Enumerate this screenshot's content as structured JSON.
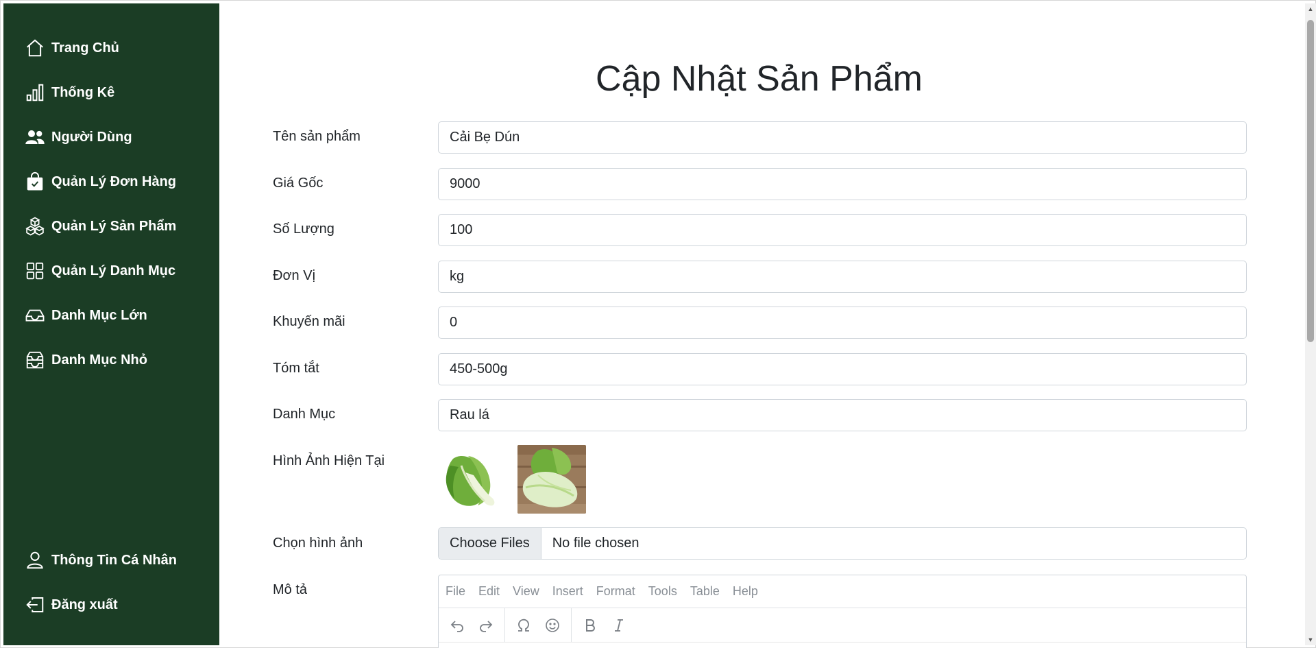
{
  "sidebar": {
    "items": [
      {
        "label": "Trang Chủ",
        "icon": "house-icon"
      },
      {
        "label": "Thống Kê",
        "icon": "bar-chart-icon"
      },
      {
        "label": "Người Dùng",
        "icon": "users-icon"
      },
      {
        "label": "Quản Lý Đơn Hàng",
        "icon": "shopping-bag-check-icon"
      },
      {
        "label": "Quản Lý Sản Phẩm",
        "icon": "boxes-icon"
      },
      {
        "label": "Quản Lý Danh Mục",
        "icon": "grid-icon"
      },
      {
        "label": "Danh Mục Lớn",
        "icon": "inbox-icon"
      },
      {
        "label": "Danh Mục Nhỏ",
        "icon": "inboxes-icon"
      }
    ],
    "bottom": [
      {
        "label": "Thông Tin Cá Nhân",
        "icon": "person-icon"
      },
      {
        "label": "Đăng xuất",
        "icon": "box-arrow-left-icon"
      }
    ]
  },
  "page": {
    "title": "Cập Nhật Sản Phẩm"
  },
  "form": {
    "name": {
      "label": "Tên sản phẩm",
      "value": "Cải Bẹ Dún"
    },
    "price": {
      "label": "Giá Gốc",
      "value": "9000"
    },
    "quantity": {
      "label": "Số Lượng",
      "value": "100"
    },
    "unit": {
      "label": "Đơn Vị",
      "value": "kg"
    },
    "discount": {
      "label": "Khuyến mãi",
      "value": "0"
    },
    "summary": {
      "label": "Tóm tắt",
      "value": "450-500g"
    },
    "category": {
      "label": "Danh Mục",
      "value": "Rau lá"
    },
    "current_images": {
      "label": "Hình Ảnh Hiện Tại"
    },
    "choose_image": {
      "label": "Chọn hình ảnh",
      "button": "Choose Files",
      "status": "No file chosen"
    },
    "description": {
      "label": "Mô tả"
    }
  },
  "editor": {
    "menu": [
      "File",
      "Edit",
      "View",
      "Insert",
      "Format",
      "Tools",
      "Table",
      "Help"
    ],
    "tools": [
      "undo-icon",
      "redo-icon",
      "omega-icon",
      "emoji-icon",
      "bold-icon",
      "italic-icon"
    ]
  },
  "colors": {
    "sidebar_bg": "#1b3d25",
    "sidebar_text": "#ffffff",
    "input_border": "#ced4da",
    "file_button_bg": "#e9ecef"
  }
}
